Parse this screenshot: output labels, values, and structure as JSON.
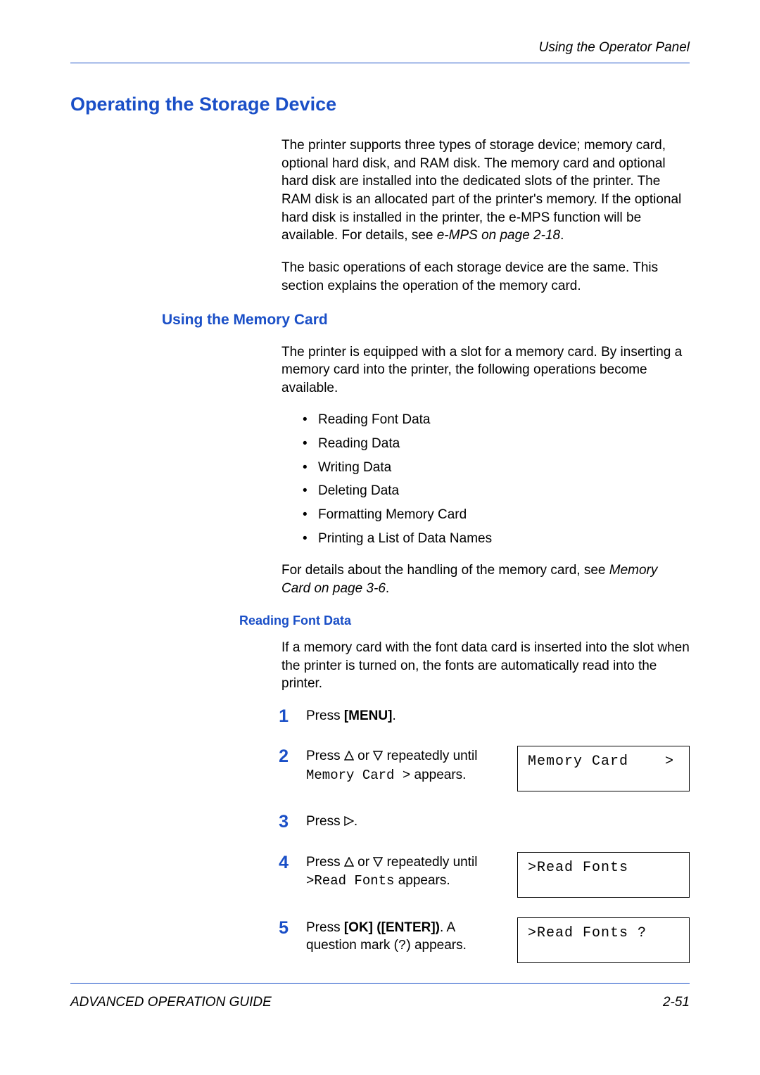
{
  "header": {
    "running": "Using the Operator Panel"
  },
  "h1": "Operating the Storage Device",
  "intro1_a": "The printer supports three types of storage device; memory card, optional hard disk, and RAM disk. The memory card and optional hard disk are installed into the dedicated slots of the printer. The RAM disk is an allocated part of the printer's memory. If the optional hard disk is installed in the printer, the e-MPS function will be available. For details, see ",
  "intro1_em": "e-MPS on page 2-18",
  "intro1_b": ".",
  "intro2": "The basic operations of each storage device are the same. This section explains the operation of the memory card.",
  "h2": "Using the Memory Card",
  "mem_intro": "The printer is equipped with a slot for a memory card. By inserting a memory card into the printer, the following operations become available.",
  "bullets": [
    "Reading Font Data",
    "Reading Data",
    "Writing Data",
    "Deleting Data",
    "Formatting Memory Card",
    "Printing a List of Data Names"
  ],
  "mem_detail_a": "For details about the handling of the memory card, see ",
  "mem_detail_em": "Memory Card on page 3-6",
  "mem_detail_b": ".",
  "h3": "Reading Font Data",
  "rfd_intro": "If a memory card with the font data card is inserted into the slot when the printer is turned on, the fonts are automatically read into the printer.",
  "steps": {
    "s1": {
      "pre": "Press ",
      "bold": "[MENU]",
      "post": "."
    },
    "s2": {
      "pre": "Press  ",
      "mid": " or ",
      "post1": " repeatedly until ",
      "mono": "Memory Card >",
      "post2": " appears.",
      "lcd": "Memory Card    >"
    },
    "s3": {
      "pre": "Press ",
      "post": "."
    },
    "s4": {
      "pre": "Press  ",
      "mid": " or ",
      "post1": " repeatedly until ",
      "mono": ">Read Fonts",
      "post2": " appears.",
      "lcd": ">Read Fonts"
    },
    "s5": {
      "pre": "Press ",
      "bold": "[OK] ([ENTER])",
      "mid": ". A question mark (",
      "mono": "?",
      "post": ") appears.",
      "lcd": ">Read Fonts ?"
    }
  },
  "footer": {
    "left": "ADVANCED OPERATION GUIDE",
    "right": "2-51"
  }
}
